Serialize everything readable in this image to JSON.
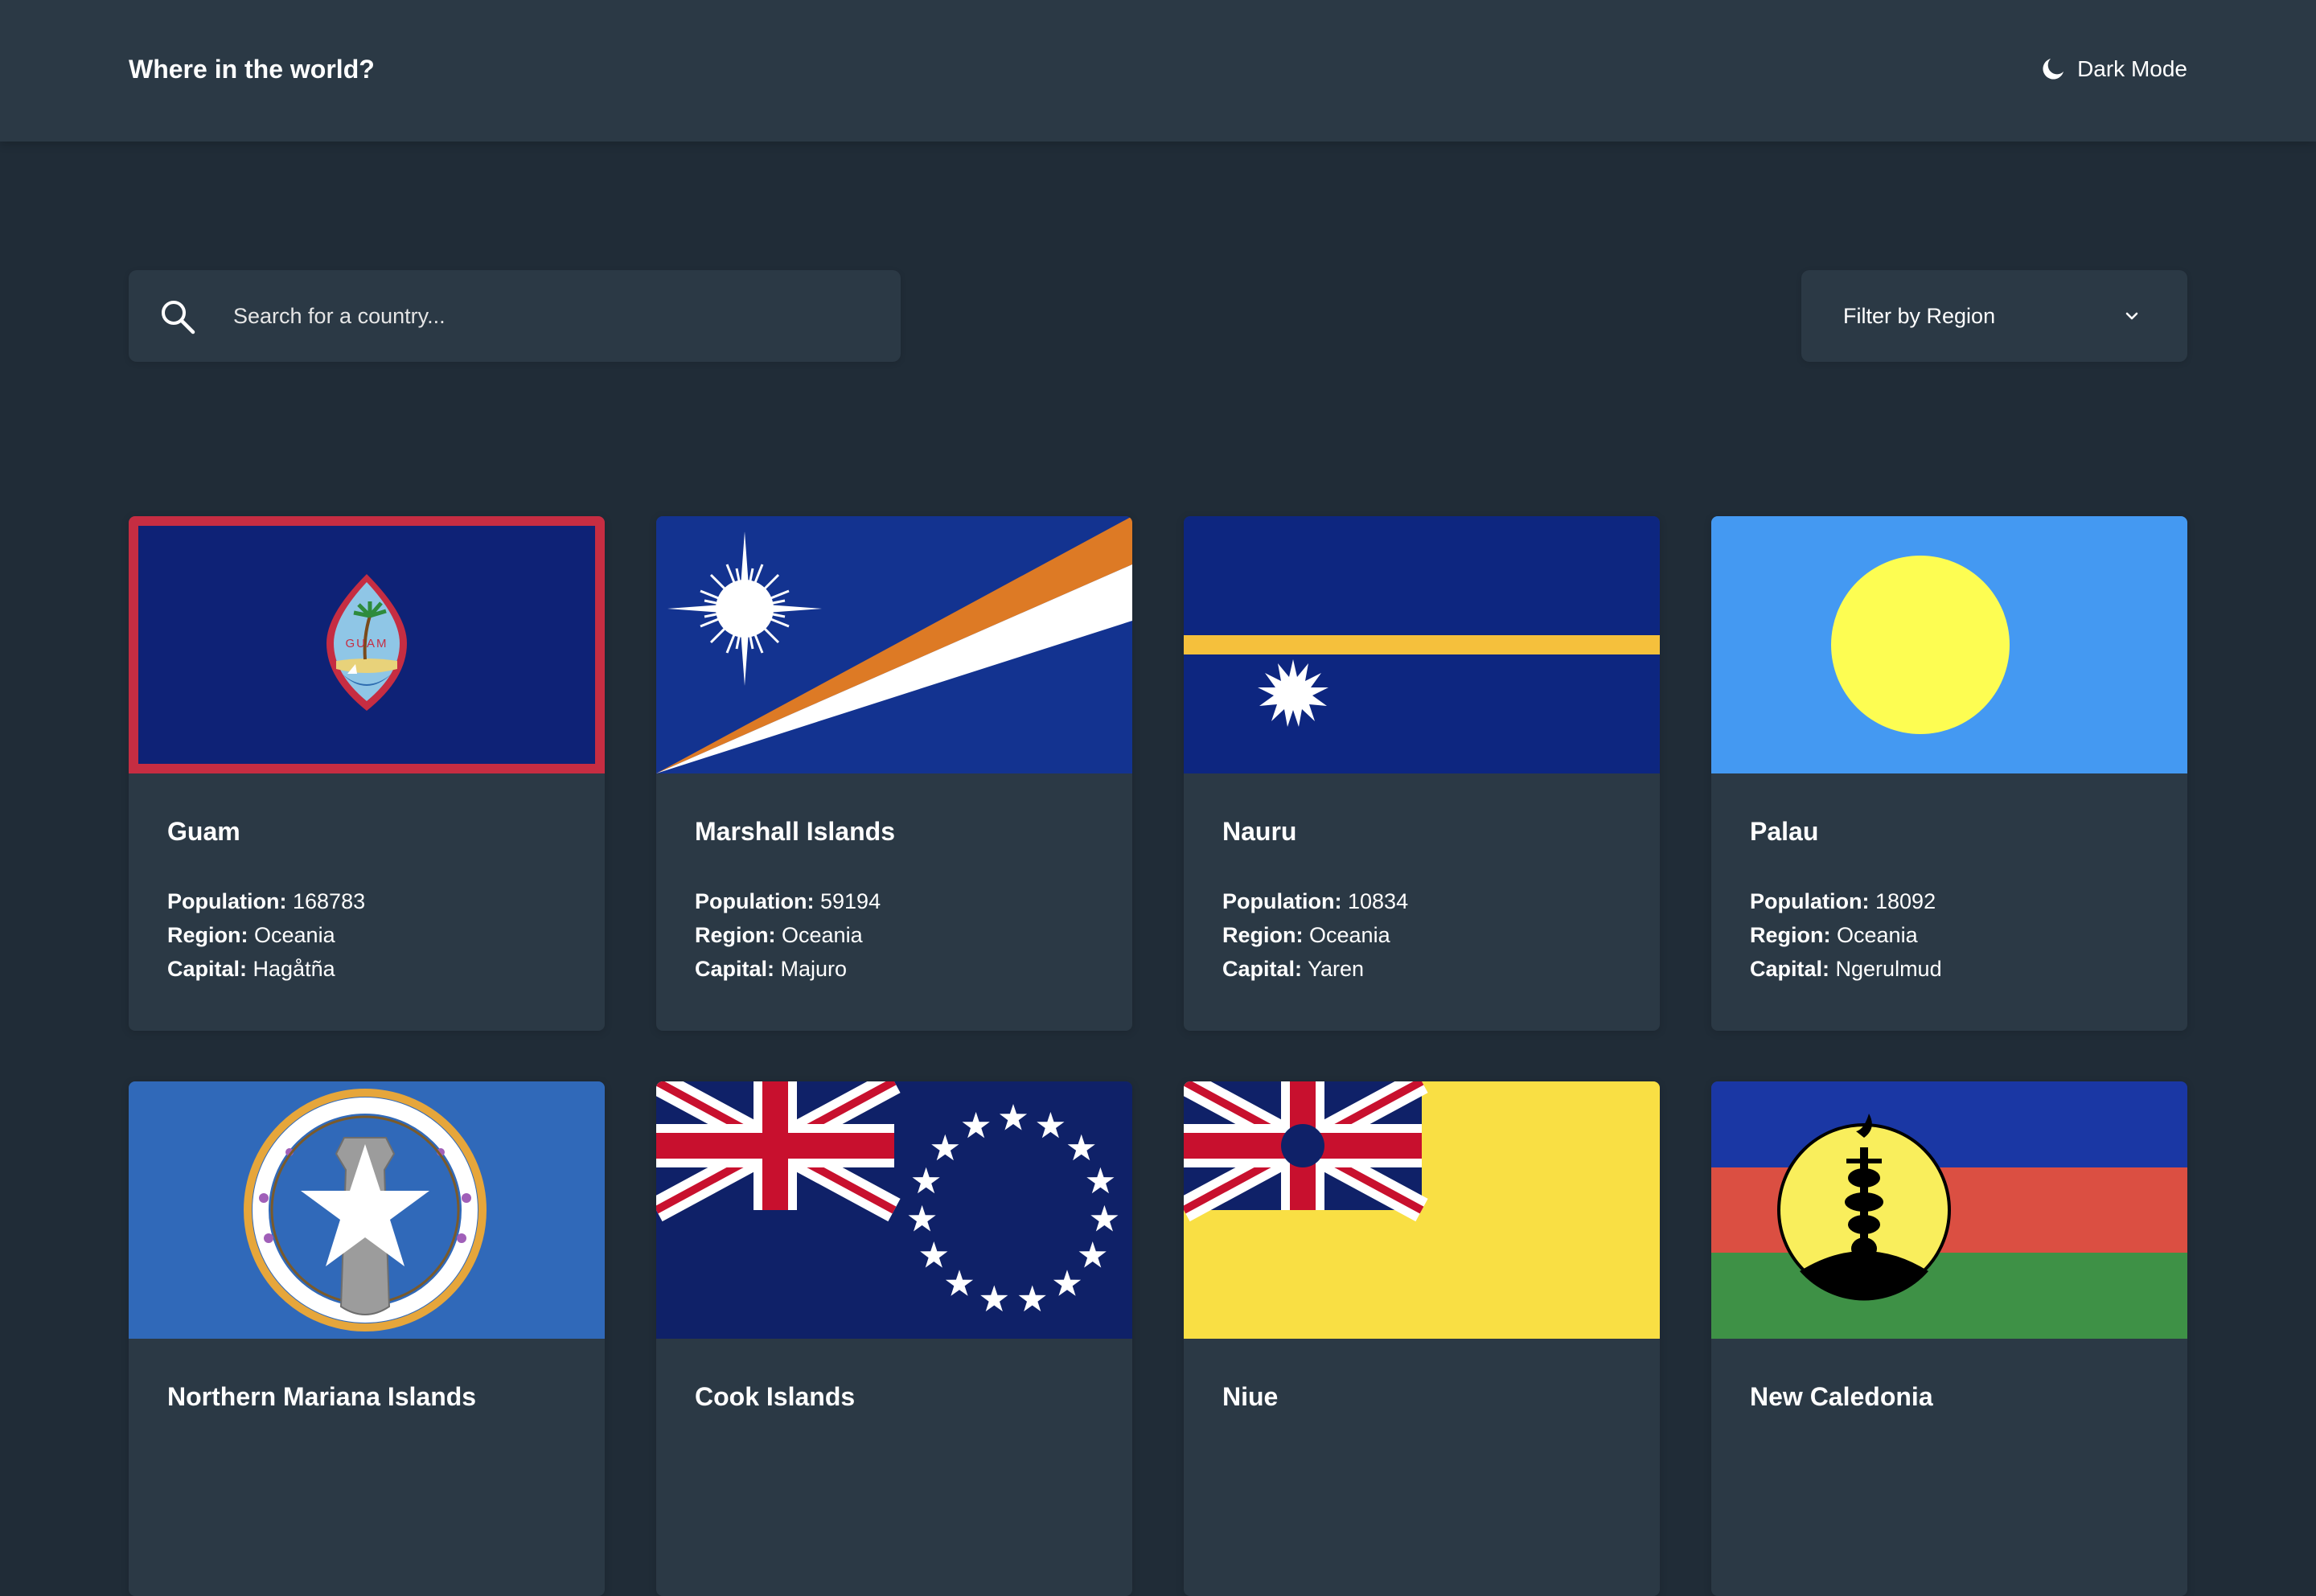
{
  "header": {
    "title": "Where in the world?",
    "theme_label": "Dark Mode",
    "theme_icon": "moon-icon"
  },
  "search": {
    "placeholder": "Search for a country...",
    "value": "",
    "icon": "search-icon"
  },
  "filter": {
    "label": "Filter by Region",
    "icon": "chevron-down-icon"
  },
  "labels": {
    "population": "Population:",
    "region": "Region:",
    "capital": "Capital:"
  },
  "countries": [
    {
      "name": "Guam",
      "population": "168783",
      "region": "Oceania",
      "capital": "Hagåtña"
    },
    {
      "name": "Marshall Islands",
      "population": "59194",
      "region": "Oceania",
      "capital": "Majuro"
    },
    {
      "name": "Nauru",
      "population": "10834",
      "region": "Oceania",
      "capital": "Yaren"
    },
    {
      "name": "Palau",
      "population": "18092",
      "region": "Oceania",
      "capital": "Ngerulmud"
    },
    {
      "name": "Northern Mariana Islands"
    },
    {
      "name": "Cook Islands"
    },
    {
      "name": "Niue"
    },
    {
      "name": "New Caledonia"
    }
  ],
  "colors": {
    "background": "#202c37",
    "element": "#2b3945",
    "text": "#ffffff"
  }
}
